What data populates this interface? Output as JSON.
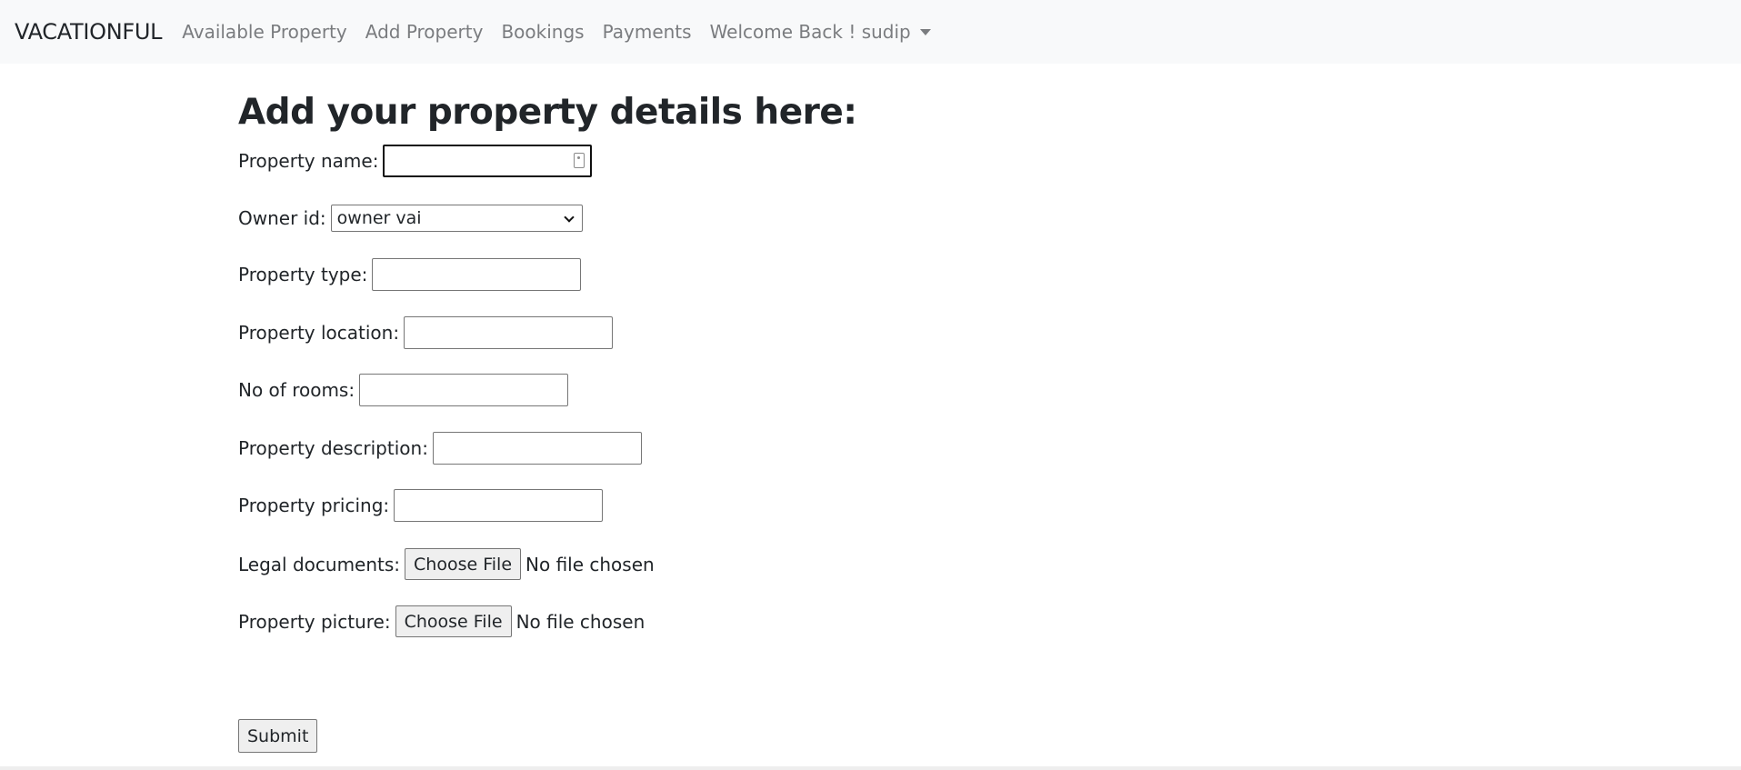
{
  "navbar": {
    "brand": "VACATIONFUL",
    "links": [
      "Available Property",
      "Add Property",
      "Bookings",
      "Payments"
    ],
    "user_menu": "Welcome Back ! sudip"
  },
  "form": {
    "heading": "Add your property details here:",
    "property_name_label": "Property name:",
    "property_name_value": "",
    "owner_label": "Owner id:",
    "owner_selected": "owner vai",
    "property_type_label": "Property type:",
    "property_location_label": "Property location:",
    "rooms_label": "No of rooms:",
    "description_label": "Property description:",
    "pricing_label": "Property pricing:",
    "legal_docs_label": "Legal documents:",
    "picture_label": "Property picture:",
    "choose_file": "Choose File",
    "no_file": "No file chosen",
    "submit": "Submit"
  }
}
